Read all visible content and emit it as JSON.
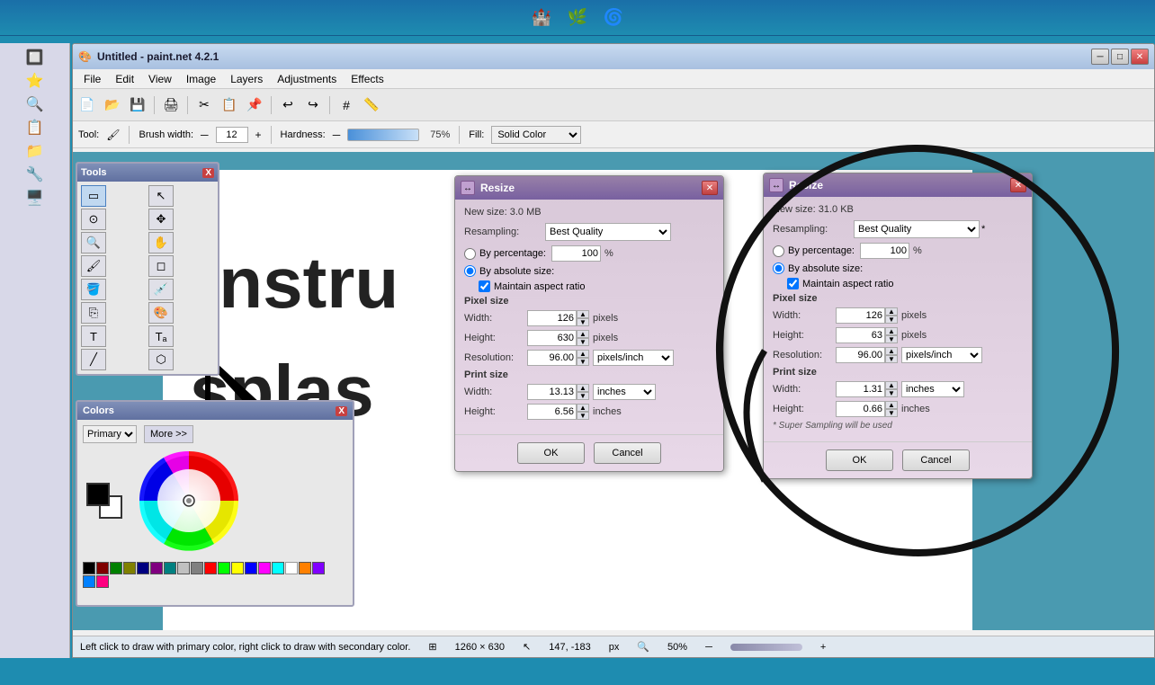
{
  "taskbar": {
    "icons": [
      "🏰",
      "🌿",
      "🌀"
    ]
  },
  "main_window": {
    "title": "Untitled - paint.net 4.2.1",
    "icon": "🎨"
  },
  "menu": {
    "items": [
      "File",
      "Edit",
      "View",
      "Image",
      "Layers",
      "Adjustments",
      "Effects"
    ]
  },
  "tool_options": {
    "tool_label": "Tool:",
    "brush_width_label": "Brush width:",
    "brush_width_value": "12",
    "hardness_label": "Hardness:",
    "hardness_value": "75%",
    "fill_label": "Fill:",
    "fill_value": "Solid Color"
  },
  "tools_panel": {
    "title": "Tools",
    "close": "X"
  },
  "color_panel": {
    "title": "Colors",
    "close": "X",
    "primary_label": "Primary",
    "more_label": "More >>",
    "palette_colors": [
      "#000000",
      "#800000",
      "#008000",
      "#808000",
      "#000080",
      "#800080",
      "#008080",
      "#c0c0c0",
      "#808080",
      "#ff0000",
      "#00ff00",
      "#ffff00",
      "#0000ff",
      "#ff00ff",
      "#00ffff",
      "#ffffff",
      "#ff8000",
      "#8000ff",
      "#0080ff",
      "#ff0080"
    ]
  },
  "resize_dialog_1": {
    "title": "Resize",
    "new_size_label": "New size: 3.0 MB",
    "resampling_label": "Resampling:",
    "resampling_value": "Best Quality",
    "by_percentage_label": "By percentage:",
    "percentage_value": "100",
    "percentage_unit": "%",
    "by_absolute_label": "By absolute size:",
    "maintain_aspect_label": "Maintain aspect ratio",
    "pixel_size_label": "Pixel size",
    "width_label": "Width:",
    "width_value": "126",
    "width_unit": "pixels",
    "height_label": "Height:",
    "height_value": "630",
    "height_unit": "pixels",
    "resolution_label": "Resolution:",
    "resolution_value": "96.00",
    "resolution_unit": "pixels/inch",
    "print_size_label": "Print size",
    "print_width_label": "Width:",
    "print_width_value": "13.13",
    "print_width_unit": "inches",
    "print_height_label": "Height:",
    "print_height_value": "6.56",
    "print_height_unit": "inches",
    "ok_label": "OK",
    "cancel_label": "Cancel"
  },
  "resize_dialog_2": {
    "title": "Resize",
    "new_size_label": "New size: 31.0 KB",
    "resampling_label": "Resampling:",
    "resampling_value": "Best Quality",
    "by_percentage_label": "By percentage:",
    "percentage_value": "100",
    "percentage_unit": "%",
    "by_absolute_label": "By absolute size:",
    "maintain_aspect_label": "Maintain aspect ratio",
    "pixel_size_label": "Pixel size",
    "width_label": "Width:",
    "width_value": "126",
    "width_unit": "pixels",
    "height_label": "Height:",
    "height_value": "63",
    "height_unit": "pixels",
    "resolution_label": "Resolution:",
    "resolution_value": "96.00",
    "resolution_unit": "pixels/inch",
    "print_size_label": "Print size",
    "print_width_label": "Width:",
    "print_width_value": "1.31",
    "print_width_unit": "inches",
    "print_height_label": "Height:",
    "print_height_value": "0.66",
    "print_height_unit": "inches",
    "super_sampling_note": "* Super Sampling will be used",
    "ok_label": "OK",
    "cancel_label": "Cancel"
  },
  "status_bar": {
    "hint": "Left click to draw with primary color, right click to draw with secondary color.",
    "size": "1260 × 630",
    "cursor": "147, -183",
    "unit": "px",
    "zoom": "50%"
  }
}
